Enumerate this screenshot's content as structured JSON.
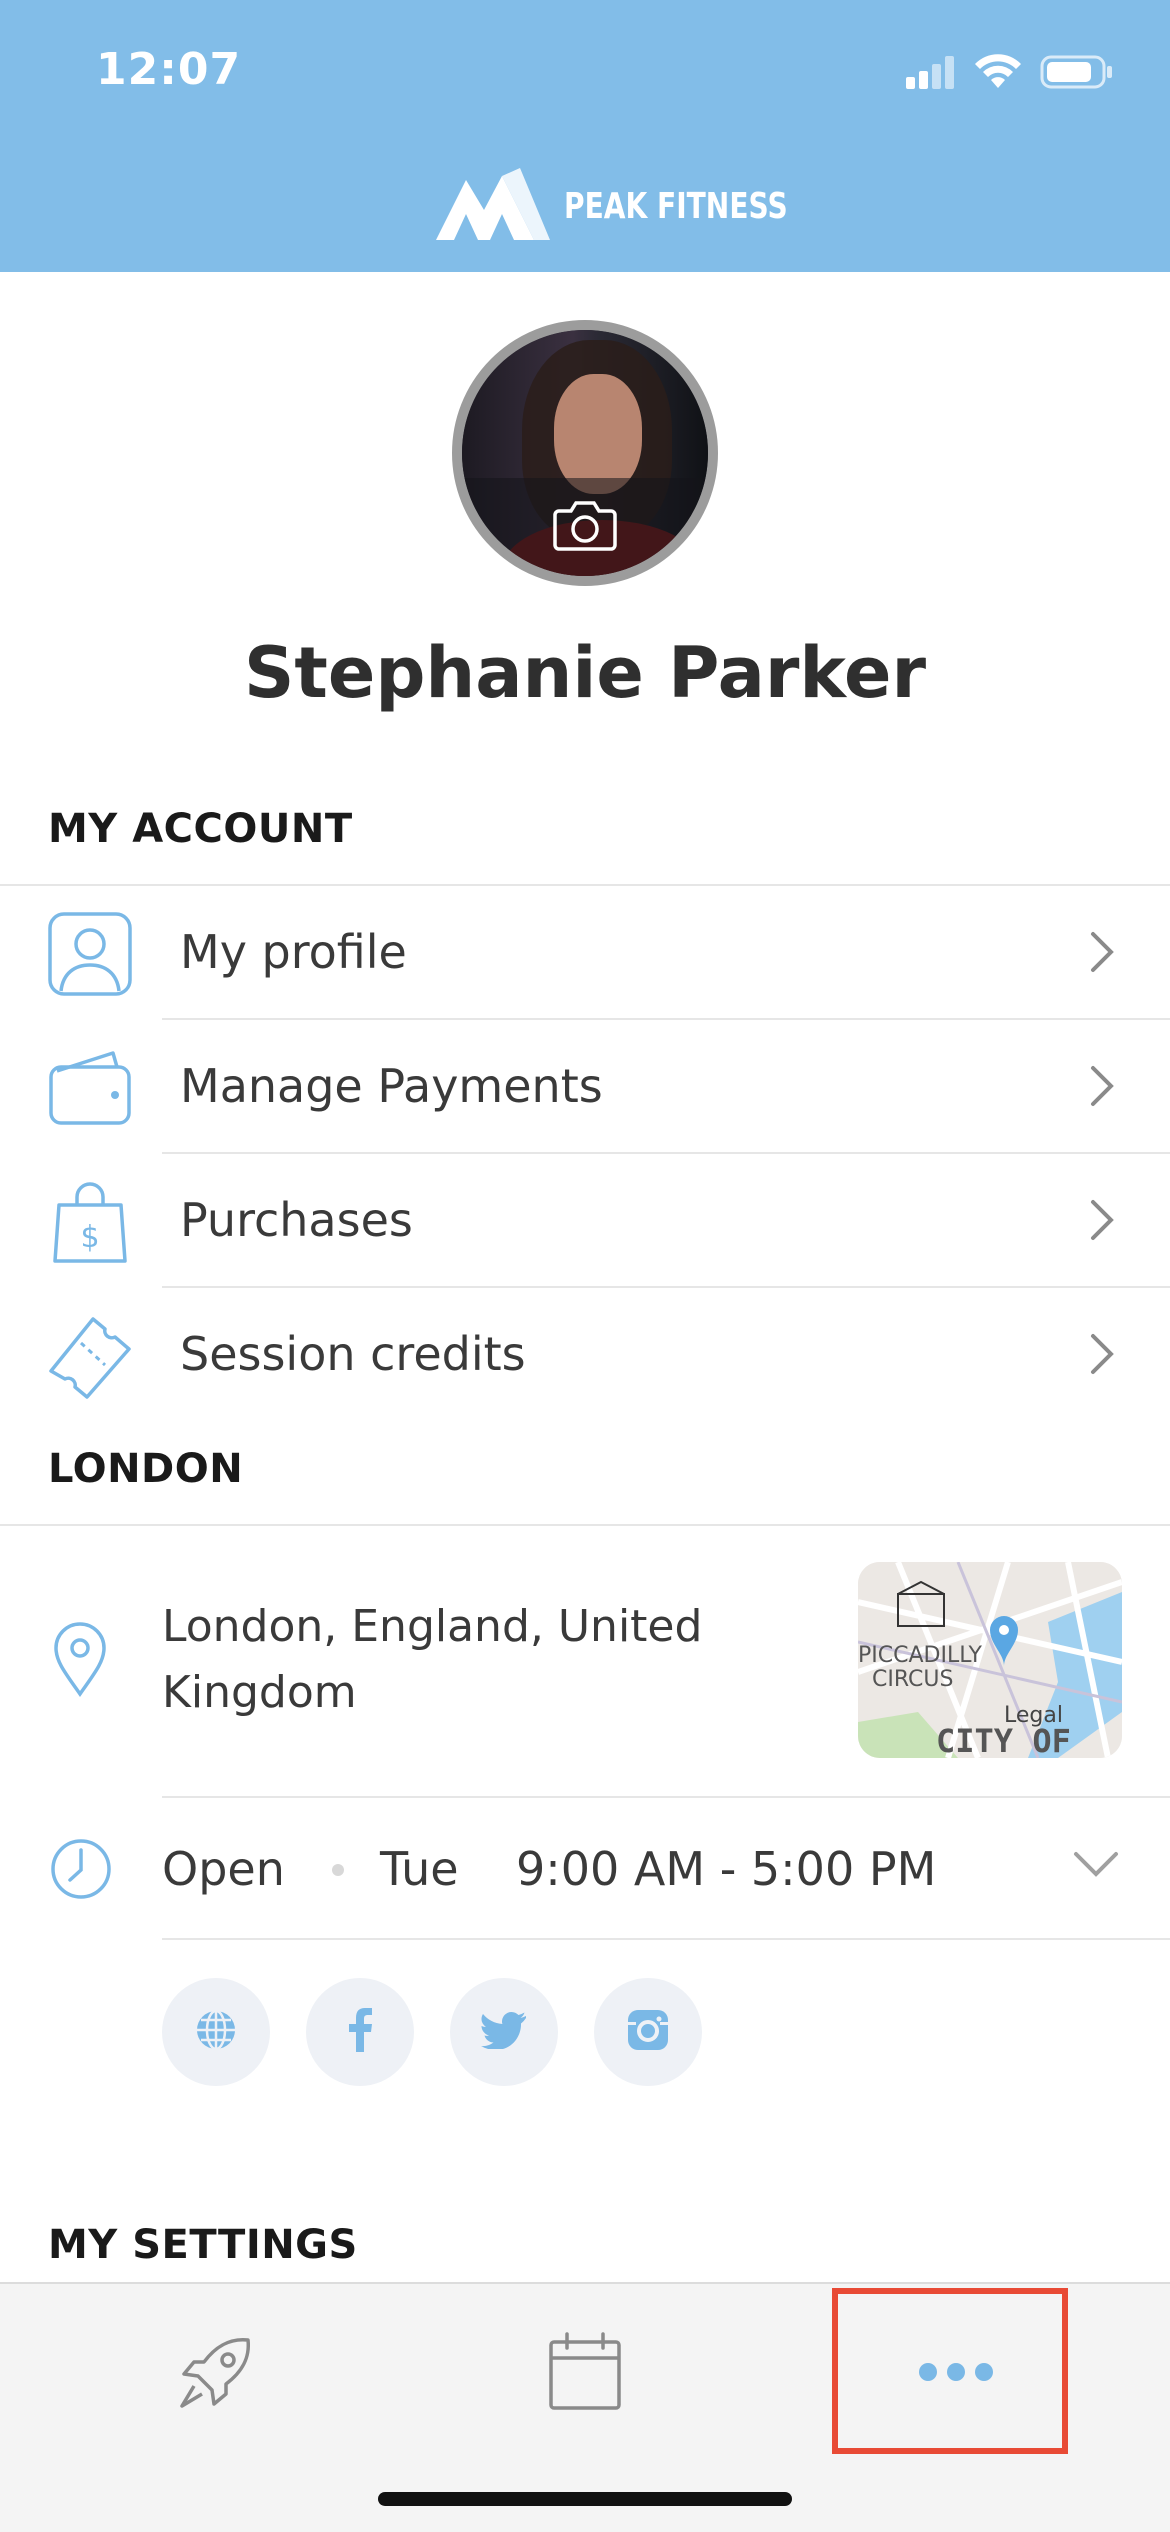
{
  "status_bar": {
    "time": "12:07"
  },
  "header": {
    "brand": "PEAK FITNESS",
    "colors": {
      "header_bg": "#82bde8",
      "accent": "#7ab8e6"
    }
  },
  "profile": {
    "name": "Stephanie Parker",
    "avatar_action_icon": "camera-icon"
  },
  "my_account": {
    "title": "MY ACCOUNT",
    "items": [
      {
        "label": "My profile",
        "icon": "person-icon"
      },
      {
        "label": "Manage Payments",
        "icon": "wallet-icon"
      },
      {
        "label": "Purchases",
        "icon": "shopping-bag-icon"
      },
      {
        "label": "Session credits",
        "icon": "ticket-icon"
      }
    ]
  },
  "location": {
    "title": "LONDON",
    "address": "London, England, United Kingdom",
    "map": {
      "label_1": "PICCADILLY",
      "label_2": "CIRCUS",
      "label_3": "Legal",
      "label_4": "CITY OF"
    },
    "hours": {
      "status": "Open",
      "day": "Tue",
      "time": "9:00 AM - 5:00 PM"
    },
    "social": [
      "globe-icon",
      "facebook-icon",
      "twitter-icon",
      "instagram-icon"
    ]
  },
  "my_settings": {
    "title": "MY SETTINGS"
  },
  "tabbar": {
    "items": [
      "rocket-icon",
      "calendar-icon",
      "more-icon"
    ],
    "selected": "more-icon",
    "highlight_color": "#e84a35"
  }
}
